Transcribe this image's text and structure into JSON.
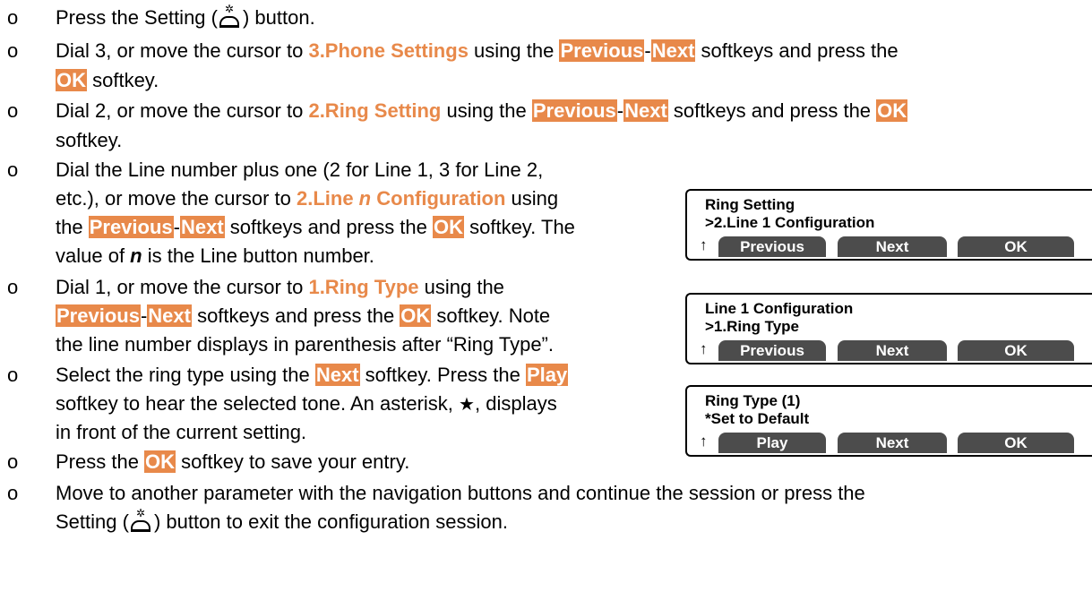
{
  "bullet_glyph": "o",
  "icons": {
    "setting_icon": "setting-button-icon"
  },
  "colors": {
    "label_orange": "#e8894a",
    "softkey_bg": "#e8894a",
    "lcd_key_bg": "#4c4c4c"
  },
  "steps": [
    {
      "a": "Press the Setting (",
      "b": ") button."
    },
    {
      "a": "Dial 3, or move the cursor to ",
      "label": "3.Phone Settings",
      "b": " using the ",
      "prev": "Previous",
      "dash": "-",
      "next": "Next",
      "c": " softkeys and press the",
      "ok": "OK",
      "d": " softkey."
    },
    {
      "a": "Dial 2, or move the cursor to ",
      "label": "2.Ring Setting",
      "b": " using the ",
      "prev": "Previous",
      "dash": "-",
      "next": "Next",
      "c": " softkeys and press the ",
      "ok": "OK",
      "d": "softkey."
    },
    {
      "l1": "Dial the Line number plus one (2 for Line 1, 3 for Line 2,",
      "l2a": "etc.), or move the cursor to ",
      "label_a": "2.Line ",
      "label_n": "n",
      "label_b": " Configuration",
      "l2b": " using",
      "l3a": "the ",
      "prev": "Previous",
      "dash": "-",
      "next": "Next",
      "l3b": " softkeys and press the ",
      "ok": "OK",
      "l3c": " softkey. The",
      "l4a": "value of ",
      "n": "n",
      "l4b": " is the Line button number."
    },
    {
      "l1a": "Dial 1, or move the cursor to ",
      "label": "1.Ring Type",
      "l1b": " using the",
      "prev": "Previous",
      "dash": "-",
      "next": "Next",
      "l2b": " softkeys and press the ",
      "ok": "OK",
      "l2c": " softkey.  Note",
      "l3": "the line number displays in parenthesis after “Ring Type”."
    },
    {
      "l1a": "Select the ring type using the ",
      "next": "Next",
      "l1b": " softkey.  Press the ",
      "play": "Play",
      "l2a": "softkey to hear the selected tone.  An asterisk, ",
      "star": "★",
      "l2b": ", displays",
      "l3": "in front of the current setting."
    },
    {
      "a": "Press the ",
      "ok": "OK",
      "b": " softkey to save your entry."
    },
    {
      "l1": "Move to another parameter with the navigation buttons and continue the session or press the",
      "l2a": "Setting (",
      "l2b": ") button to exit the configuration session."
    }
  ],
  "lcd_panels": [
    {
      "line1": "Ring Setting",
      "line2": ">2.Line 1 Configuration",
      "up": "↑",
      "keys": [
        "Previous",
        "Next",
        "OK"
      ]
    },
    {
      "line1": "Line 1 Configuration",
      "line2": ">1.Ring Type",
      "up": "↑",
      "keys": [
        "Previous",
        "Next",
        "OK"
      ]
    },
    {
      "line1": "Ring Type (1)",
      "line2": "*Set to Default",
      "up": "↑",
      "keys": [
        "Play",
        "Next",
        "OK"
      ]
    }
  ]
}
